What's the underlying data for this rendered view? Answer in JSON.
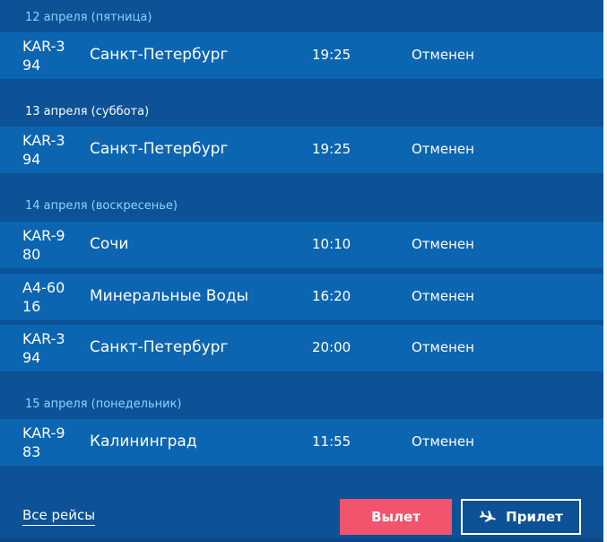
{
  "days": [
    {
      "header": "12 апреля (пятница)",
      "flights": [
        {
          "code": "KAR-394",
          "city": "Санкт-Петербург",
          "time": "19:25",
          "status": "Отменен"
        }
      ]
    },
    {
      "header": "13 апреля (суббота)",
      "flights": [
        {
          "code": "KAR-394",
          "city": "Санкт-Петербург",
          "time": "19:25",
          "status": "Отменен"
        }
      ]
    },
    {
      "header": "14 апреля (воскресенье)",
      "flights": [
        {
          "code": "KAR-980",
          "city": "Сочи",
          "time": "10:10",
          "status": "Отменен"
        },
        {
          "code": "A4-6016",
          "city": "Минеральные Воды",
          "time": "16:20",
          "status": "Отменен"
        },
        {
          "code": "KAR-394",
          "city": "Санкт-Петербург",
          "time": "20:00",
          "status": "Отменен"
        }
      ]
    },
    {
      "header": "15 апреля (понедельник)",
      "flights": [
        {
          "code": "KAR-983",
          "city": "Калининград",
          "time": "11:55",
          "status": "Отменен"
        }
      ]
    }
  ],
  "footer": {
    "all_flights": "Все рейсы",
    "departures": "Вылет",
    "arrivals": "Прилет",
    "arrivals_icon": "plane-landing-icon"
  },
  "colors": {
    "board_bg": "#0d5196",
    "row_bg": "#0c65b1",
    "header_highlight": "#8fd3ff",
    "departures_btn": "#f2546d"
  }
}
